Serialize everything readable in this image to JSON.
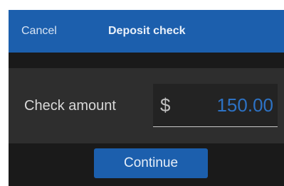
{
  "nav": {
    "cancel_label": "Cancel",
    "title": "Deposit check"
  },
  "form": {
    "amount_label": "Check amount",
    "currency_symbol": "$",
    "amount_value": "150.00"
  },
  "actions": {
    "continue_label": "Continue"
  },
  "colors": {
    "nav_bar": "#1c5fad",
    "button": "#1c5fad",
    "amount_text": "#2d72c4",
    "background": "#1a1a1a",
    "row_background": "#2e2e2e"
  }
}
